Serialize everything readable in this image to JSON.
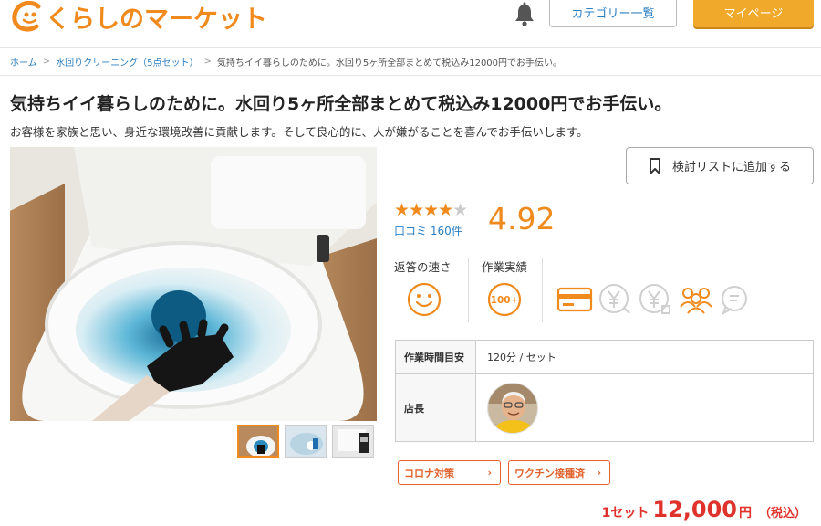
{
  "header": {
    "logo_text": "くらしのマーケット",
    "category_button": "カテゴリー一覧",
    "mypage_button": "マイページ"
  },
  "breadcrumb": {
    "home": "ホーム",
    "category": "水回りクリーニング（5点セット）",
    "current": "気持ちイイ暮らしのために。水回り5ヶ所全部まとめて税込み12000円でお手伝い。"
  },
  "listing": {
    "title": "気持ちイイ暮らしのために。水回り5ヶ所全部まとめて税込み12000円でお手伝い。",
    "subtitle": "お客様を家族と思い、身近な環境改善に貢献します。そして良心的に、人が嫌がることを喜んでお手伝いします。"
  },
  "wishlist_button": "検討リストに追加する",
  "rating": {
    "stars_filled": "★★★★",
    "stars_empty": "★",
    "reviews": "口コミ 160件",
    "score": "4.92",
    "value": 4.92
  },
  "metrics": {
    "speed_label": "返答の速さ",
    "record_label": "作業実績",
    "record_badge": "100+"
  },
  "info": {
    "duration_label": "作業時間目安",
    "duration_value": "120分 / セット",
    "manager_label": "店長"
  },
  "tags": [
    {
      "label": "コロナ対策"
    },
    {
      "label": "ワクチン接種済"
    }
  ],
  "price": {
    "unit": "1セット",
    "amount": "12,000",
    "yen": "円",
    "tax": "（税込）"
  },
  "colors": {
    "brand_orange": "#f08a1c",
    "price_red": "#e0322c",
    "link_blue": "#2b7fc2",
    "mypage_yellow": "#f0a92a"
  }
}
